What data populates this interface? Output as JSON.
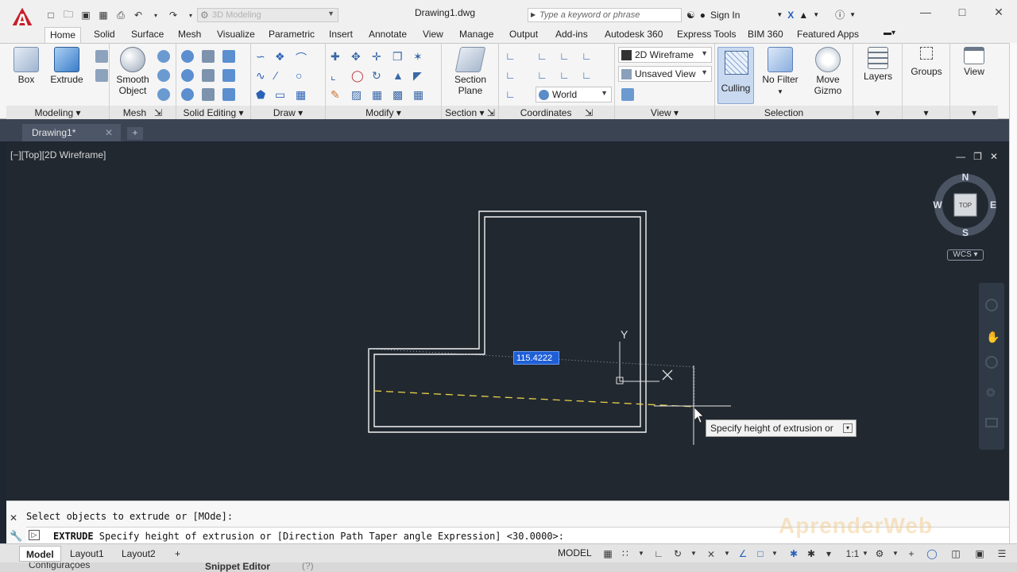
{
  "title_bar": {
    "document_title": "Drawing1.dwg",
    "workspace": "3D Modeling",
    "search_placeholder": "Type a keyword or phrase",
    "sign_in": "Sign In"
  },
  "ribbon_tabs": [
    "Home",
    "Solid",
    "Surface",
    "Mesh",
    "Visualize",
    "Parametric",
    "Insert",
    "Annotate",
    "View",
    "Manage",
    "Output",
    "Add-ins",
    "Autodesk 360",
    "Express Tools",
    "BIM 360",
    "Featured Apps"
  ],
  "active_tab": "Home",
  "ribbon": {
    "modeling": {
      "title": "Modeling",
      "box": "Box",
      "extrude": "Extrude"
    },
    "mesh": {
      "title": "Mesh",
      "smooth_object_1": "Smooth",
      "smooth_object_2": "Object"
    },
    "solid_editing": {
      "title": "Solid Editing"
    },
    "draw": {
      "title": "Draw"
    },
    "modify": {
      "title": "Modify"
    },
    "section": {
      "title": "Section",
      "section_plane_1": "Section",
      "section_plane_2": "Plane"
    },
    "coordinates": {
      "title": "Coordinates",
      "ucs": "World"
    },
    "view": {
      "title": "View",
      "visual_style": "2D Wireframe",
      "named_view": "Unsaved View"
    },
    "selection": {
      "title": "Selection",
      "culling": "Culling",
      "no_filter": "No Filter",
      "move_gizmo_1": "Move",
      "move_gizmo_2": "Gizmo"
    },
    "layers": "Layers",
    "groups": "Groups",
    "view_panel": "View"
  },
  "document_tab": "Drawing1*",
  "viewport": {
    "label": "[−][Top][2D Wireframe]",
    "dynamic_input": "115.4222",
    "tooltip": "Specify height of extrusion or",
    "ucs_y": "Y",
    "compass": {
      "n": "N",
      "s": "S",
      "e": "E",
      "w": "W",
      "top": "TOP"
    },
    "wcs": "WCS"
  },
  "command_line": {
    "history": "Select objects to extrude or [MOde]:",
    "command": "EXTRUDE",
    "prompt": " Specify height of extrusion or [Direction Path Taper angle Expression] <30.0000>:"
  },
  "status_bar": {
    "layouts": [
      "Model",
      "Layout1",
      "Layout2"
    ],
    "model_label": "MODEL",
    "scale": "1:1"
  },
  "watermark": "AprenderWeb",
  "background_window": {
    "config": "Configurações",
    "snippet": "Snippet Editor"
  },
  "colors": {
    "viewport_bg": "#212830",
    "accent": "#1f5fd6",
    "logo": "#c8202a"
  }
}
